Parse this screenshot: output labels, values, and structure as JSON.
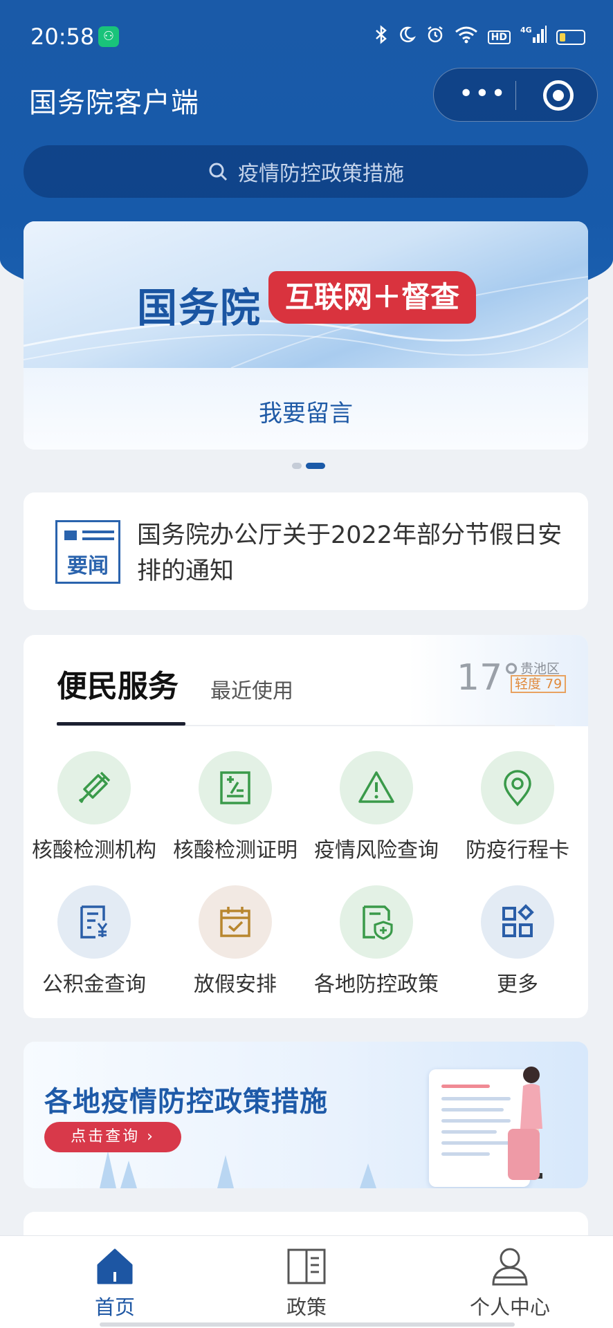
{
  "status_bar": {
    "time": "20:58",
    "icons": [
      "bluetooth-icon",
      "moon-icon",
      "alarm-icon",
      "wifi-icon",
      "hd-icon",
      "signal-4g-icon",
      "battery-icon"
    ],
    "hd": "HD",
    "network": "4G"
  },
  "header": {
    "title": "国务院客户端",
    "more_button": "•••"
  },
  "search": {
    "placeholder": "疫情防控政策措施"
  },
  "banner": {
    "title": "国务院",
    "tag": "互联网＋督查",
    "link": "我要留言",
    "pages": 2,
    "active_page": 2
  },
  "news": {
    "icon_label": "要闻",
    "text": "国务院办公厅关于2022年部分节假日安排的通知"
  },
  "services": {
    "tab_active": "便民服务",
    "tab_other": "最近使用",
    "weather": {
      "temperature": "17°",
      "district": "贵池区",
      "air_quality": "轻度 79"
    },
    "items": [
      {
        "label": "核酸检测机构",
        "icon": "dropper-icon"
      },
      {
        "label": "核酸检测证明",
        "icon": "certificate-icon"
      },
      {
        "label": "疫情风险查询",
        "icon": "warning-icon"
      },
      {
        "label": "防疫行程卡",
        "icon": "location-pin-icon"
      },
      {
        "label": "公积金查询",
        "icon": "fund-document-icon"
      },
      {
        "label": "放假安排",
        "icon": "calendar-check-icon"
      },
      {
        "label": "各地防控政策",
        "icon": "shield-document-icon"
      },
      {
        "label": "更多",
        "icon": "grid-more-icon"
      }
    ]
  },
  "promo": {
    "title": "各地疫情防控政策措施",
    "button": "点击查询"
  },
  "tabbar": {
    "items": [
      {
        "label": "首页",
        "icon": "home-icon",
        "active": true
      },
      {
        "label": "政策",
        "icon": "book-icon",
        "active": false
      },
      {
        "label": "个人中心",
        "icon": "person-icon",
        "active": false
      }
    ]
  },
  "colors": {
    "primary": "#1a5aa8",
    "accent_red": "#d9333e",
    "icon_green": "#3a9a4a",
    "icon_blue": "#2a5ea8",
    "icon_brown": "#b8862e"
  }
}
